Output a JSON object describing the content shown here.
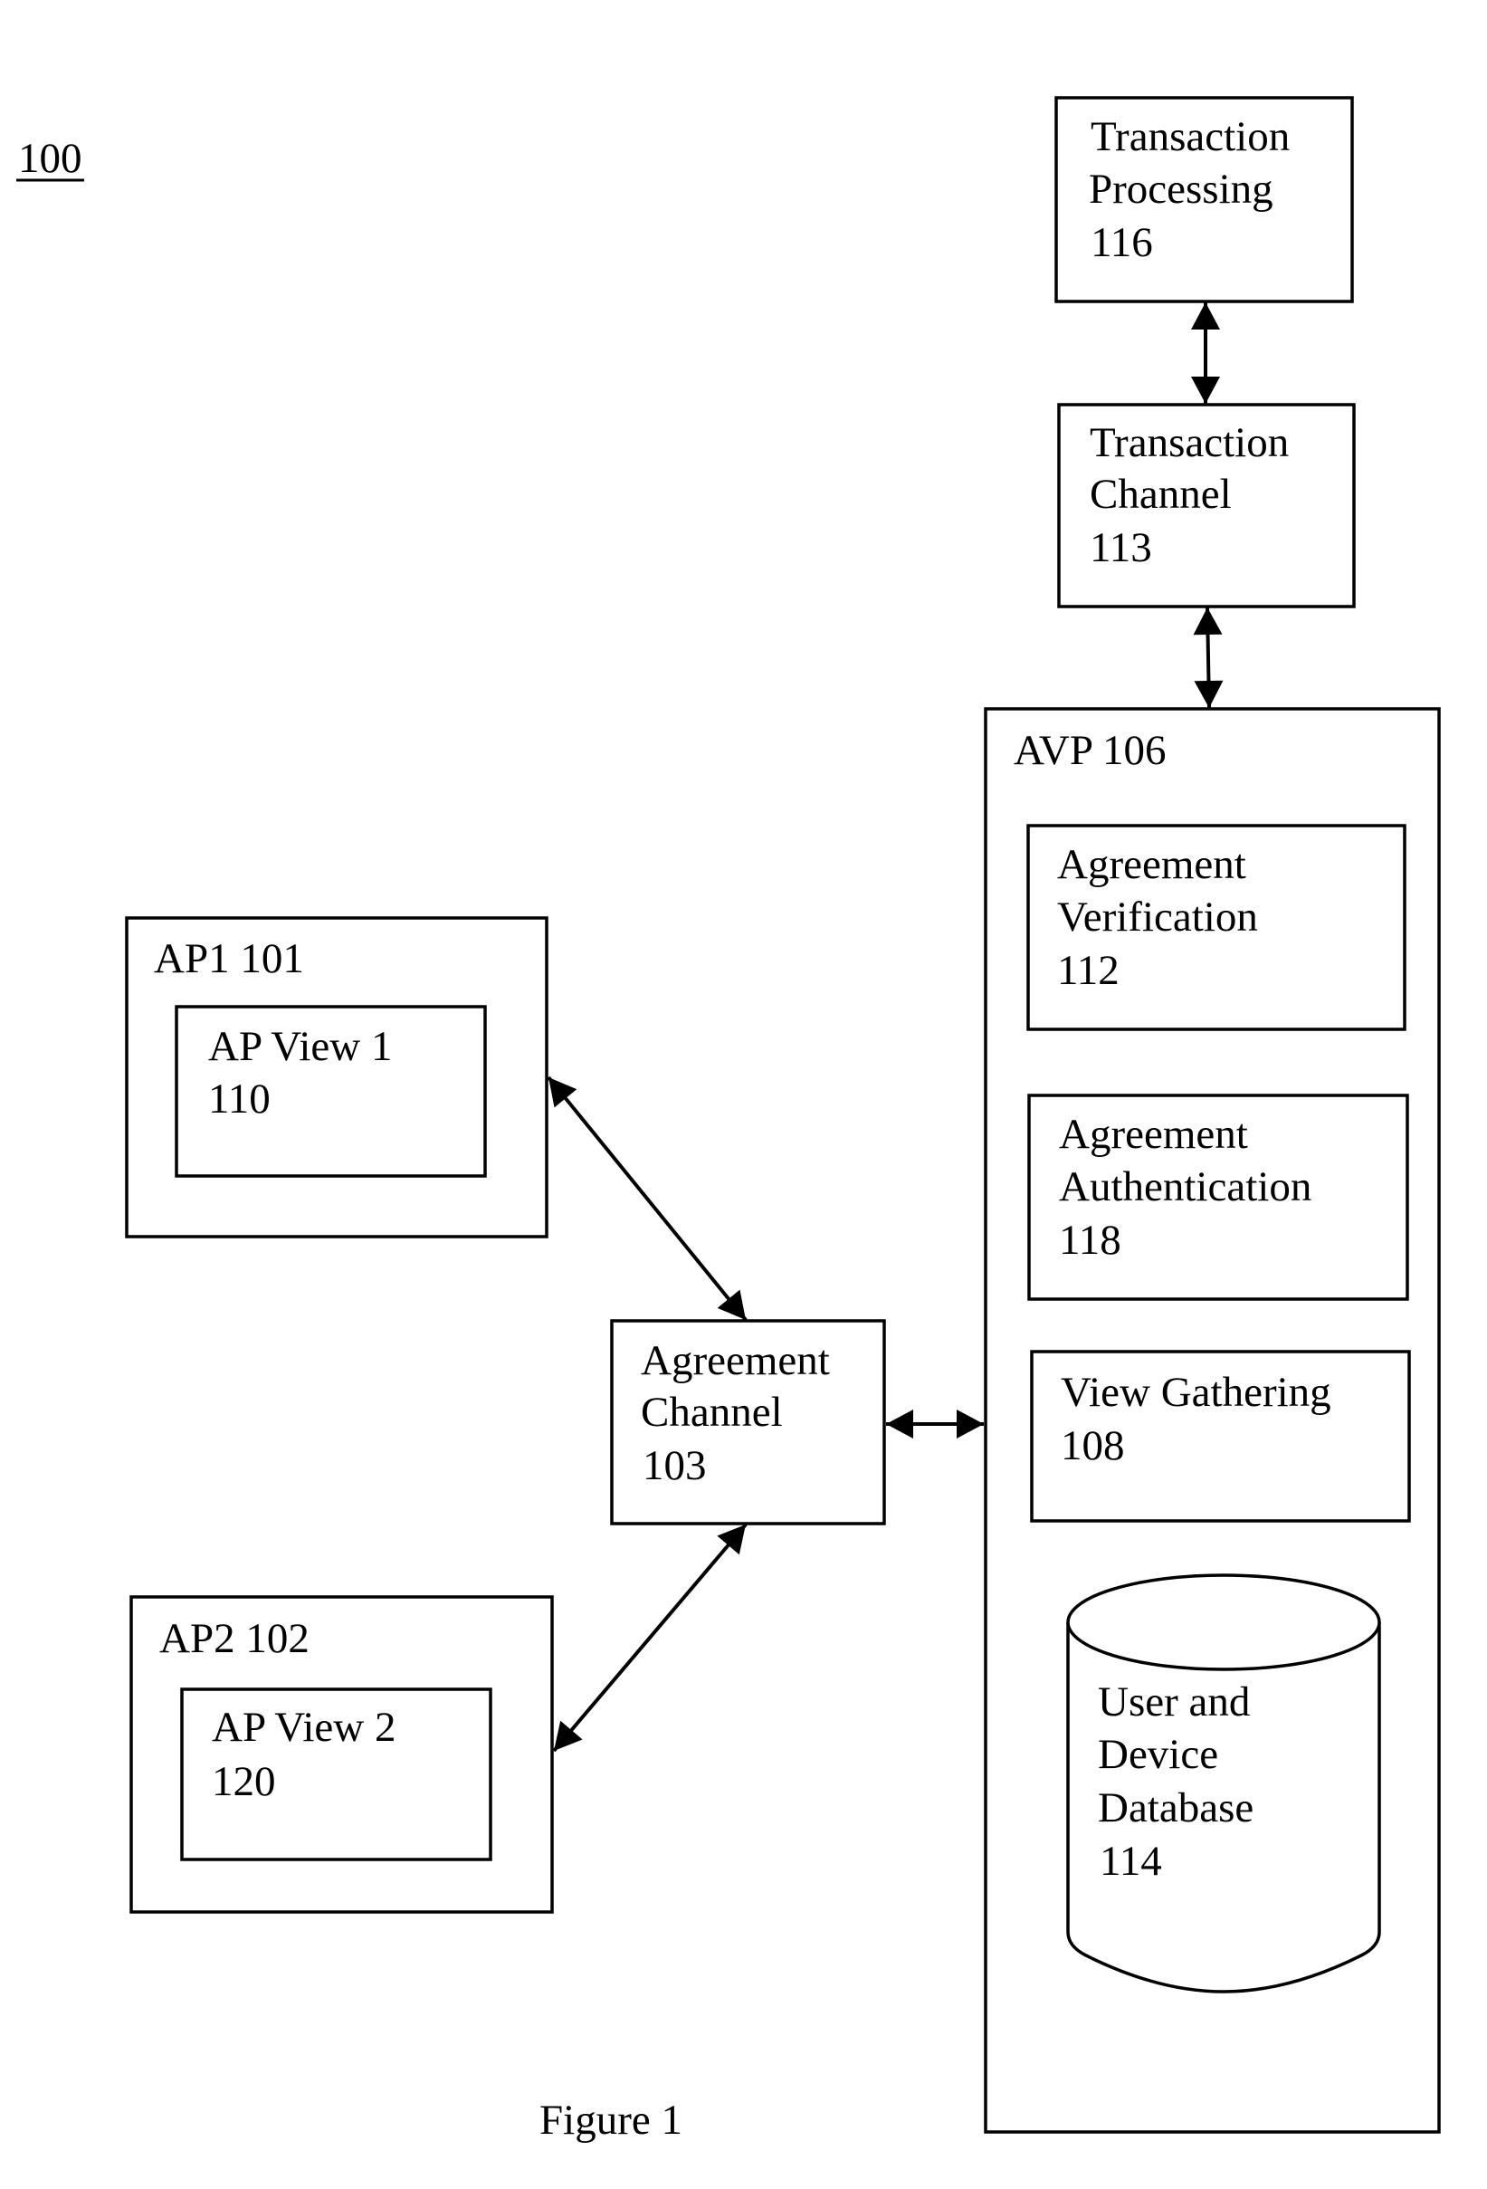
{
  "figure_ref": "100",
  "caption": "Figure 1",
  "nodes": {
    "transaction_processing": {
      "lines": [
        "Transaction",
        "Processing",
        "116"
      ]
    },
    "transaction_channel": {
      "lines": [
        "Transaction",
        "Channel",
        "113"
      ]
    },
    "avp": {
      "lines": [
        "AVP 106"
      ]
    },
    "agreement_verification": {
      "lines": [
        "Agreement",
        "Verification",
        "112"
      ]
    },
    "agreement_authentication": {
      "lines": [
        "Agreement",
        "Authentication",
        "118"
      ]
    },
    "view_gathering": {
      "lines": [
        "View Gathering",
        "108"
      ]
    },
    "user_device_database": {
      "lines": [
        "User and",
        "Device",
        "Database",
        "114"
      ]
    },
    "ap1": {
      "lines": [
        "AP1 101"
      ]
    },
    "ap_view_1": {
      "lines": [
        "AP View 1",
        "110"
      ]
    },
    "ap2": {
      "lines": [
        "AP2 102"
      ]
    },
    "ap_view_2": {
      "lines": [
        "AP View 2",
        "120"
      ]
    },
    "agreement_channel": {
      "lines": [
        "Agreement",
        "Channel",
        "103"
      ]
    }
  },
  "edges": [
    {
      "from": "Transaction Processing 116",
      "to": "Transaction Channel 113",
      "direction": "bidirectional"
    },
    {
      "from": "Transaction Channel 113",
      "to": "AVP 106",
      "direction": "bidirectional"
    },
    {
      "from": "AP1 101",
      "to": "Agreement Channel 103",
      "direction": "bidirectional"
    },
    {
      "from": "AP2 102",
      "to": "Agreement Channel 103",
      "direction": "bidirectional"
    },
    {
      "from": "Agreement Channel 103",
      "to": "AVP 106",
      "direction": "bidirectional"
    }
  ]
}
